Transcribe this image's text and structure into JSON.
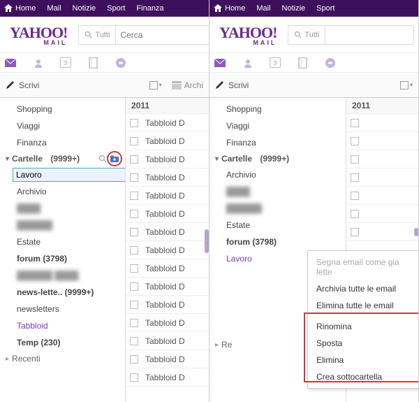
{
  "topnav": [
    "Home",
    "Mail",
    "Notizie",
    "Sport",
    "Finanza"
  ],
  "topnav_right": [
    "Home",
    "Mail",
    "Notizie",
    "Sport"
  ],
  "logo": {
    "big": "YAHOO!",
    "small": "MAIL"
  },
  "search": {
    "all": "Tutti",
    "placeholder_left": "Cerca",
    "placeholder_right": "Tutti"
  },
  "toolbar": {
    "compose": "Scrivi",
    "archive": "Archi"
  },
  "left": {
    "above": [
      "Shopping",
      "Viaggi",
      "Finanza"
    ],
    "cartelle_label": "Cartelle",
    "cartelle_count": "(9999+)",
    "new_folder_value": "Lavoro",
    "items": [
      {
        "label": "Archivio"
      },
      {
        "label": "████",
        "blur": true
      },
      {
        "label": "██████",
        "blur": true
      },
      {
        "label": "Estate"
      },
      {
        "label": "forum  (3798)",
        "bold": true
      },
      {
        "label": "██████ ████",
        "blur": true
      },
      {
        "label": "news-lette..  (9999+)",
        "bold": true
      },
      {
        "label": "newsletters"
      },
      {
        "label": "Tabbloid",
        "purple": true
      },
      {
        "label": "Temp  (230)",
        "bold": true
      }
    ],
    "recenti": "Recenti"
  },
  "right": {
    "above": [
      "Shopping",
      "Viaggi",
      "Finanza"
    ],
    "cartelle_label": "Cartelle",
    "cartelle_count": "(9999+)",
    "items": [
      {
        "label": "Archivio"
      },
      {
        "label": "████",
        "blur": true
      },
      {
        "label": "██████",
        "blur": true
      },
      {
        "label": "Estate"
      },
      {
        "label": "forum  (3798)",
        "bold": true
      },
      {
        "label": "Lavoro",
        "purple": true
      }
    ],
    "recenti": "Re"
  },
  "msg": {
    "year": "2011",
    "subject": "Tabbloid D"
  },
  "context_menu": {
    "disabled": "Segna email come gia lette",
    "group1": [
      "Archivia tutte le email",
      "Elimina tutte le email"
    ],
    "group2": [
      "Rinomina",
      "Sposta",
      "Elimina",
      "Crea sottocartella"
    ]
  }
}
